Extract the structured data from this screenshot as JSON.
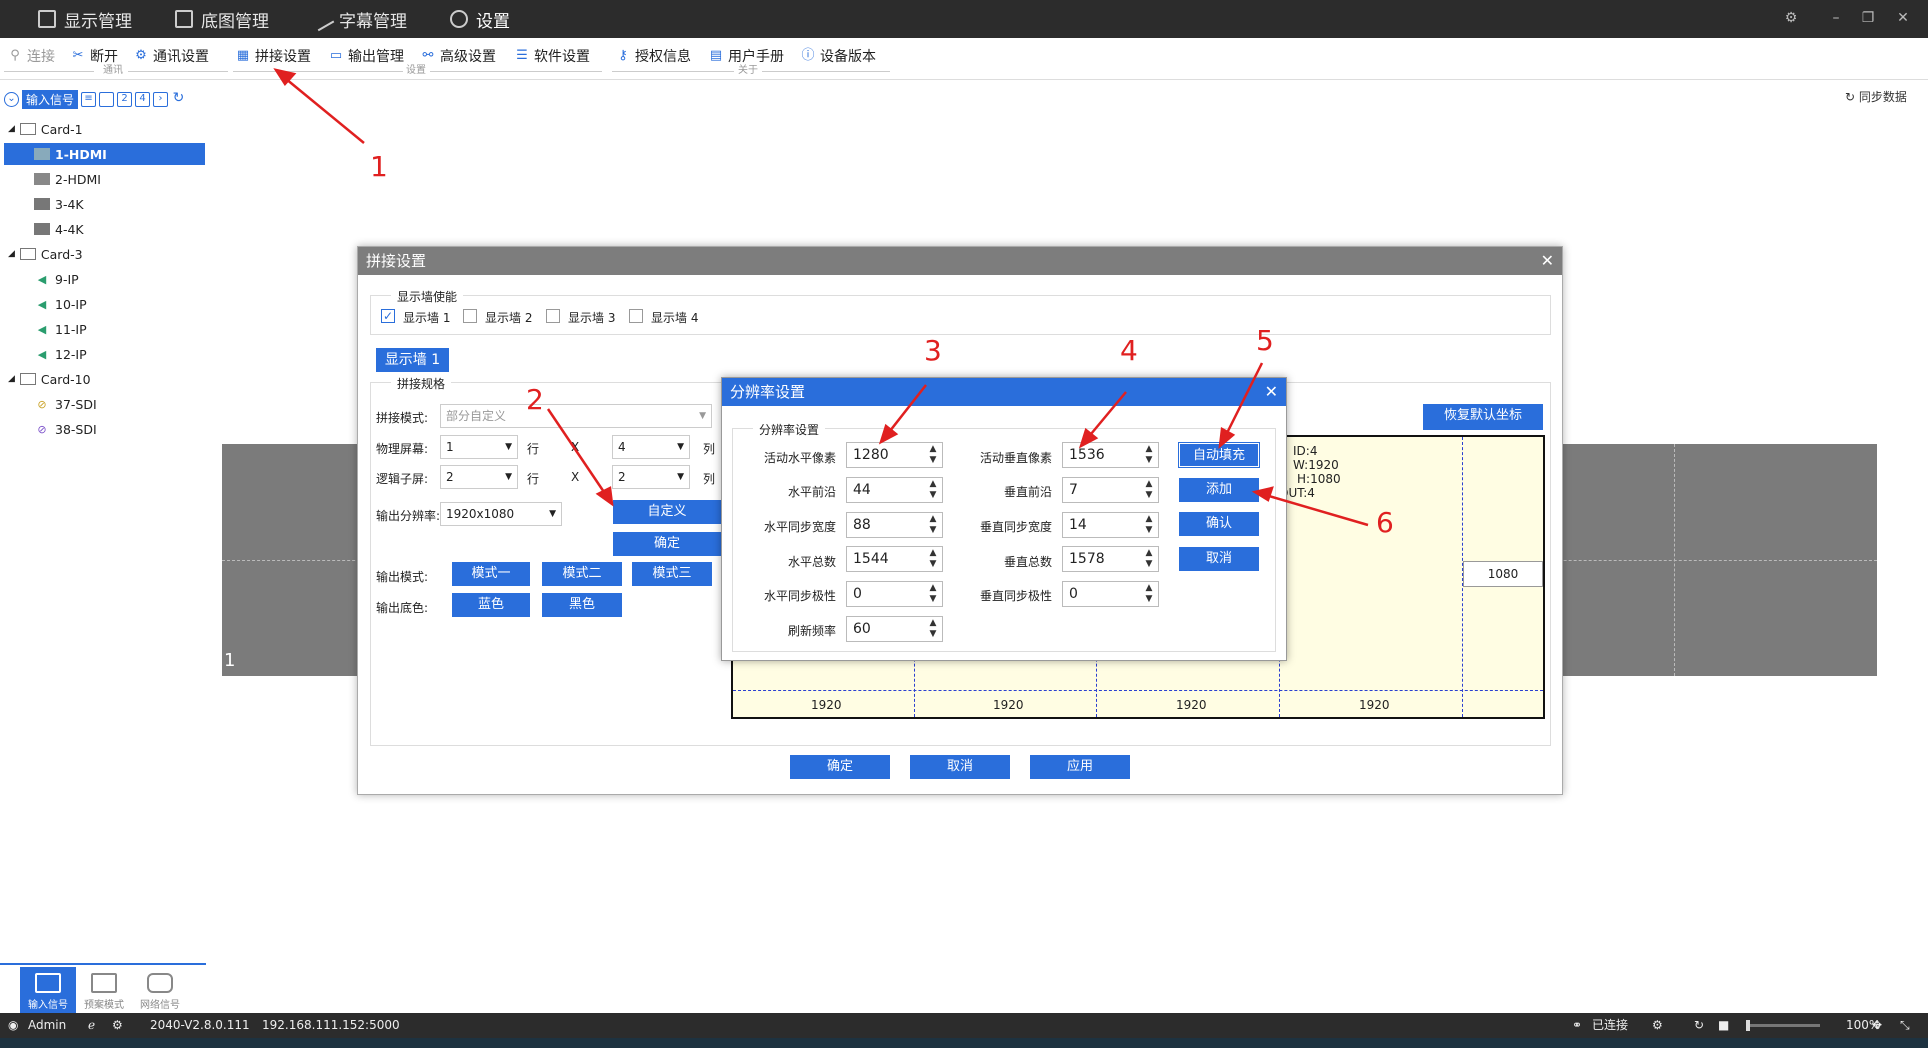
{
  "titlebar": {
    "tabs": [
      {
        "label": "显示管理"
      },
      {
        "label": "底图管理"
      },
      {
        "label": "字幕管理"
      },
      {
        "label": "设置"
      }
    ]
  },
  "toolbar": {
    "items": [
      "连接",
      "断开",
      "通讯设置",
      "拼接设置",
      "输出管理",
      "高级设置",
      "软件设置",
      "授权信息",
      "用户手册",
      "设备版本"
    ],
    "groups": [
      "通讯",
      "设置",
      "关于"
    ]
  },
  "left": {
    "header": "输入信号",
    "tree": [
      {
        "label": "Card-1",
        "level": 0
      },
      {
        "label": "1-HDMI",
        "level": 1,
        "selected": true
      },
      {
        "label": "2-HDMI",
        "level": 1
      },
      {
        "label": "3-4K",
        "level": 1
      },
      {
        "label": "4-4K",
        "level": 1
      },
      {
        "label": "Card-3",
        "level": 0
      },
      {
        "label": "9-IP",
        "level": 1
      },
      {
        "label": "10-IP",
        "level": 1
      },
      {
        "label": "11-IP",
        "level": 1
      },
      {
        "label": "12-IP",
        "level": 1
      },
      {
        "label": "Card-10",
        "level": 0
      },
      {
        "label": "37-SDI",
        "level": 1
      },
      {
        "label": "38-SDI",
        "level": 1
      }
    ],
    "bottom_tabs": [
      "输入信号",
      "预案模式",
      "网络信号"
    ]
  },
  "sync_label": "同步数据",
  "canvas_label": "1",
  "splice_dialog": {
    "title": "拼接设置",
    "enable_legend": "显示墙使能",
    "walls": [
      {
        "label": "显示墙 1",
        "checked": true
      },
      {
        "label": "显示墙 2",
        "checked": false
      },
      {
        "label": "显示墙 3",
        "checked": false
      },
      {
        "label": "显示墙 4",
        "checked": false
      }
    ],
    "wall_tab": "显示墙 1",
    "spec_legend": "拼接规格",
    "splice_mode_label": "拼接模式:",
    "splice_mode_value": "部分自定义",
    "physical_label": "物理屏幕:",
    "physical_rows": "1",
    "physical_cols": "4",
    "logical_label": "逻辑子屏:",
    "logical_rows": "2",
    "logical_cols": "2",
    "row_unit": "行",
    "col_unit": "列",
    "x_sep": "X",
    "resolution_label": "输出分辨率:",
    "resolution_value": "1920x1080",
    "custom_btn": "自定义",
    "confirm_btn": "确定",
    "output_mode_label": "输出模式:",
    "modes": [
      "模式一",
      "模式二",
      "模式三"
    ],
    "bg_color_label": "输出底色:",
    "colors": [
      "蓝色",
      "黑色"
    ],
    "restore_btn": "恢复默认坐标",
    "grid_info": [
      "ID:4",
      "W:1920",
      "H:1080",
      "OUT:4"
    ],
    "grid_width_labels": [
      "1920",
      "1920",
      "1920",
      "1920"
    ],
    "grid_height_label": "1080",
    "footer": [
      "确定",
      "取消",
      "应用"
    ]
  },
  "res_dialog": {
    "title": "分辨率设置",
    "legend": "分辨率设置",
    "left_fields": [
      {
        "label": "活动水平像素",
        "value": "1280"
      },
      {
        "label": "水平前沿",
        "value": "44"
      },
      {
        "label": "水平同步宽度",
        "value": "88"
      },
      {
        "label": "水平总数",
        "value": "1544"
      },
      {
        "label": "水平同步极性",
        "value": "0"
      },
      {
        "label": "刷新频率",
        "value": "60"
      }
    ],
    "right_fields": [
      {
        "label": "活动垂直像素",
        "value": "1536"
      },
      {
        "label": "垂直前沿",
        "value": "7"
      },
      {
        "label": "垂直同步宽度",
        "value": "14"
      },
      {
        "label": "垂直总数",
        "value": "1578"
      },
      {
        "label": "垂直同步极性",
        "value": "0"
      }
    ],
    "buttons": [
      "自动填充",
      "添加",
      "确认",
      "取消"
    ]
  },
  "annotations": [
    "1",
    "2",
    "3",
    "4",
    "5",
    "6"
  ],
  "status": {
    "user": "Admin",
    "version": "2040-V2.8.0.111",
    "address": "192.168.111.152:5000",
    "connected": "已连接",
    "zoom": "100%"
  },
  "colors": {
    "accent": "#2a6edb",
    "titlebar": "#2c2c2c",
    "annotation": "#e02020",
    "grid_fill": "#fffde3"
  }
}
